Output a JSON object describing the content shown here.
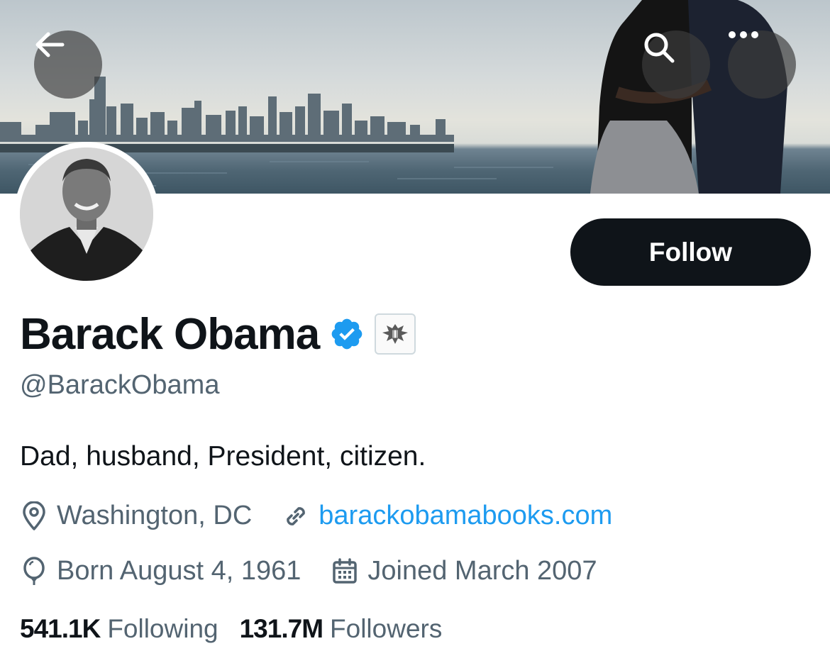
{
  "header": {
    "back_icon": "arrow-left-icon",
    "search_icon": "search-icon",
    "more_icon": "more-horizontal-icon"
  },
  "profile": {
    "name": "Barack Obama",
    "handle": "@BarackObama",
    "bio": "Dad, husband, President, citizen.",
    "verified_color": "#1d9bf0",
    "location": "Washington, DC",
    "website": "barackobamabooks.com",
    "birthday": "Born August 4, 1961",
    "joined": "Joined March 2007"
  },
  "actions": {
    "follow_label": "Follow"
  },
  "stats": {
    "following_count": "541.1K",
    "following_label": "Following",
    "followers_count": "131.7M",
    "followers_label": "Followers"
  },
  "colors": {
    "text_primary": "#0f1419",
    "text_secondary": "#536471",
    "link": "#1d9bf0",
    "button_bg": "#0f1419"
  }
}
